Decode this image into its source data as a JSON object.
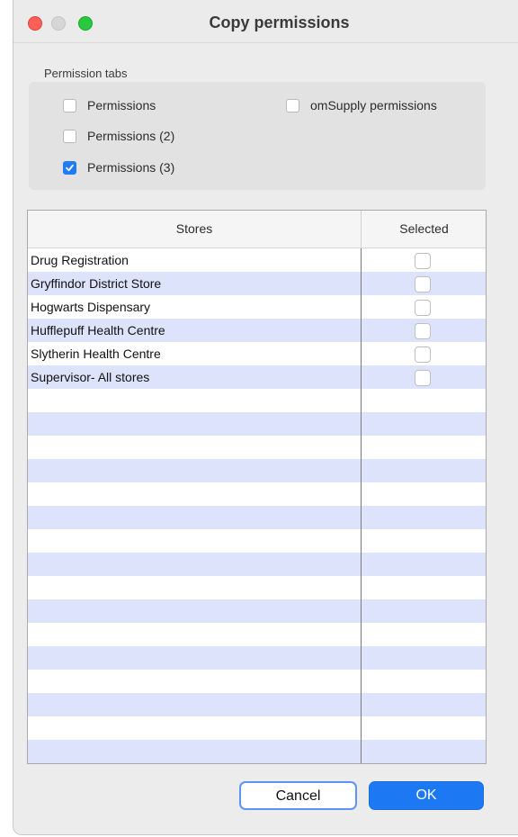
{
  "window": {
    "title": "Copy permissions"
  },
  "permission_tabs": {
    "group_label": "Permission tabs",
    "options": [
      {
        "label": "Permissions",
        "checked": false
      },
      {
        "label": "Permissions (2)",
        "checked": false
      },
      {
        "label": "Permissions (3)",
        "checked": true
      },
      {
        "label": "omSupply permissions",
        "checked": false
      }
    ]
  },
  "table": {
    "columns": [
      "Stores",
      "Selected"
    ],
    "rows": [
      {
        "store": "Drug Registration",
        "selected": false
      },
      {
        "store": "Gryffindor District Store",
        "selected": false
      },
      {
        "store": "Hogwarts Dispensary",
        "selected": false
      },
      {
        "store": "Hufflepuff Health Centre",
        "selected": false
      },
      {
        "store": "Slytherin Health Centre",
        "selected": false
      },
      {
        "store": "Supervisor- All stores",
        "selected": false
      }
    ],
    "stripe_color": "#dde3fb"
  },
  "buttons": {
    "cancel": "Cancel",
    "ok": "OK"
  },
  "colors": {
    "accent": "#1c78f3",
    "close": "#fe5f57",
    "maximize": "#28c840"
  }
}
